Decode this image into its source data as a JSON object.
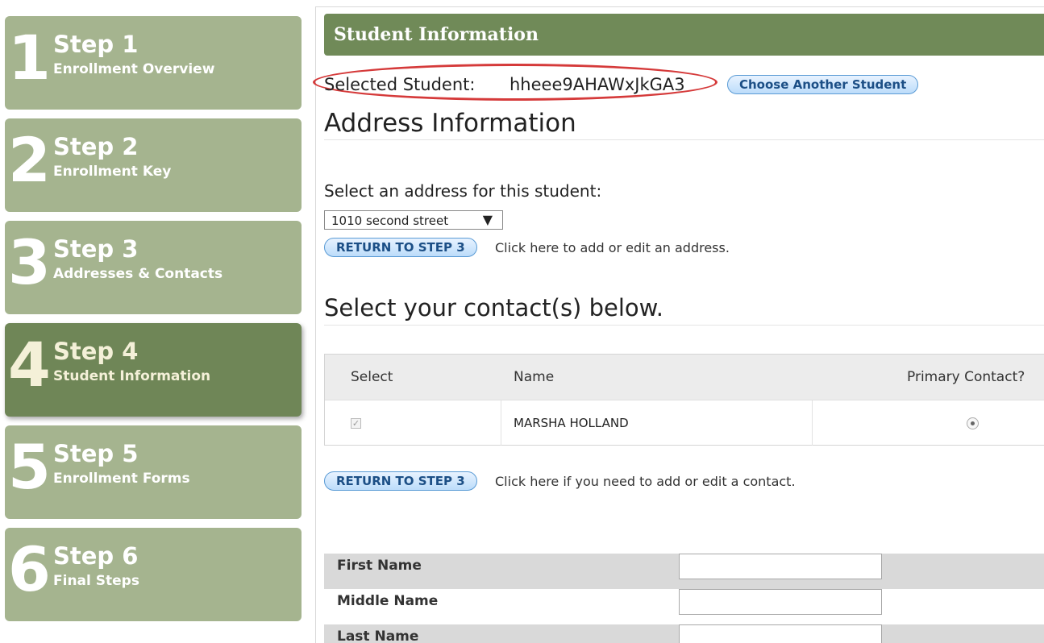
{
  "sidebar": {
    "steps": [
      {
        "number": "1",
        "title": "Step 1",
        "subtitle": "Enrollment Overview"
      },
      {
        "number": "2",
        "title": "Step 2",
        "subtitle": "Enrollment Key"
      },
      {
        "number": "3",
        "title": "Step 3",
        "subtitle": "Addresses & Contacts"
      },
      {
        "number": "4",
        "title": "Step 4",
        "subtitle": "Student Information"
      },
      {
        "number": "5",
        "title": "Step 5",
        "subtitle": "Enrollment Forms"
      },
      {
        "number": "6",
        "title": "Step 6",
        "subtitle": "Final Steps"
      }
    ],
    "active_step": "4"
  },
  "header": {
    "title": "Student Information"
  },
  "student": {
    "label": "Selected Student:",
    "value": "hheee9AHAWxJkGA3",
    "choose_button": "Choose Another Student"
  },
  "address": {
    "heading": "Address Information",
    "select_label": "Select an address for this student:",
    "selected_value": "1010 second street",
    "return_button": "RETURN TO STEP 3",
    "return_note": "Click here to add or edit an address."
  },
  "contacts": {
    "heading": "Select your contact(s) below.",
    "columns": [
      "Select",
      "Name",
      "Primary Contact?"
    ],
    "rows": [
      {
        "selected": true,
        "name": "MARSHA HOLLAND",
        "primary": true
      }
    ],
    "return_button": "RETURN TO STEP 3",
    "return_note": "Click here if you need to add or edit a contact."
  },
  "form": {
    "fields": [
      {
        "label": "First Name",
        "value": ""
      },
      {
        "label": "Middle Name",
        "value": ""
      },
      {
        "label": "Last Name",
        "value": ""
      }
    ]
  },
  "colors": {
    "step_bg": "#a5b48f",
    "step_active_bg": "#6f8657",
    "header_bar": "#708a58",
    "highlight_ellipse": "#d53a3a",
    "button_border": "#5a9bd5"
  }
}
